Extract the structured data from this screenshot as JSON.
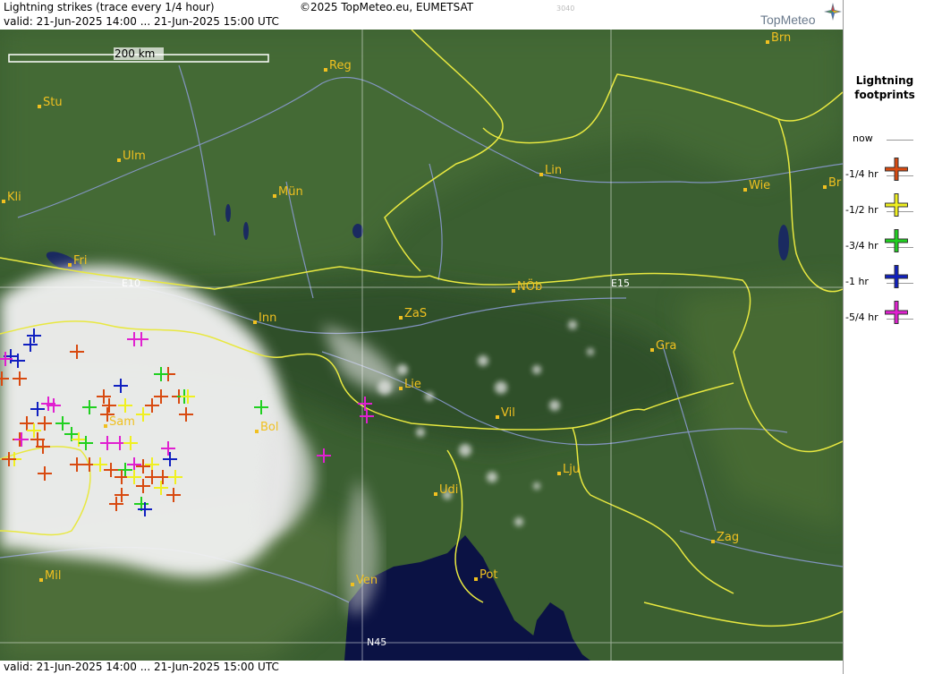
{
  "header": {
    "title": "Lightning strikes (trace every 1/4 hour)",
    "valid": "valid:  21-Jun-2025 14:00 ... 21-Jun-2025 15:00 UTC",
    "copyright": "©2025 TopMeteo.eu, EUMETSAT",
    "code": "3040",
    "logo": "TopMeteo"
  },
  "footer": {
    "valid": "valid:  21-Jun-2025 14:00 ... 21-Jun-2025 15:00 UTC"
  },
  "scale_bar": {
    "label": "200 km"
  },
  "grid_labels": {
    "e10": "E10",
    "e15": "E15",
    "n45": "N45"
  },
  "cities": [
    {
      "name": "Brn"
    },
    {
      "name": "Reg"
    },
    {
      "name": "Stu"
    },
    {
      "name": "Ulm"
    },
    {
      "name": "Lin"
    },
    {
      "name": "Kli"
    },
    {
      "name": "Mün"
    },
    {
      "name": "Wie"
    },
    {
      "name": "Br"
    },
    {
      "name": "Fri"
    },
    {
      "name": "NÖb"
    },
    {
      "name": "Inn"
    },
    {
      "name": "ZaS"
    },
    {
      "name": "Gra"
    },
    {
      "name": "Lie"
    },
    {
      "name": "Sam"
    },
    {
      "name": "Bol"
    },
    {
      "name": "Vil"
    },
    {
      "name": "Lju"
    },
    {
      "name": "Udi"
    },
    {
      "name": "Zag"
    },
    {
      "name": "Mil"
    },
    {
      "name": "Pot"
    },
    {
      "name": "Ven"
    }
  ],
  "legend": {
    "title_line1": "Lightning",
    "title_line2": "footprints",
    "entries": [
      {
        "label": "now",
        "color": ""
      },
      {
        "label": "-1/4 hr",
        "color": "#d84a10"
      },
      {
        "label": "-1/2 hr",
        "color": "#f0f020"
      },
      {
        "label": "-3/4 hr",
        "color": "#20d020"
      },
      {
        "label": "-1 hr",
        "color": "#1020c0"
      },
      {
        "label": "-5/4 hr",
        "color": "#e020d0"
      }
    ]
  },
  "colors": {
    "border": "#e8e840",
    "river": "#8a9ad0",
    "sea": "#0a1040",
    "land": "#3a6030",
    "cloud": "#f4f4f4",
    "city": "#f0c020"
  }
}
